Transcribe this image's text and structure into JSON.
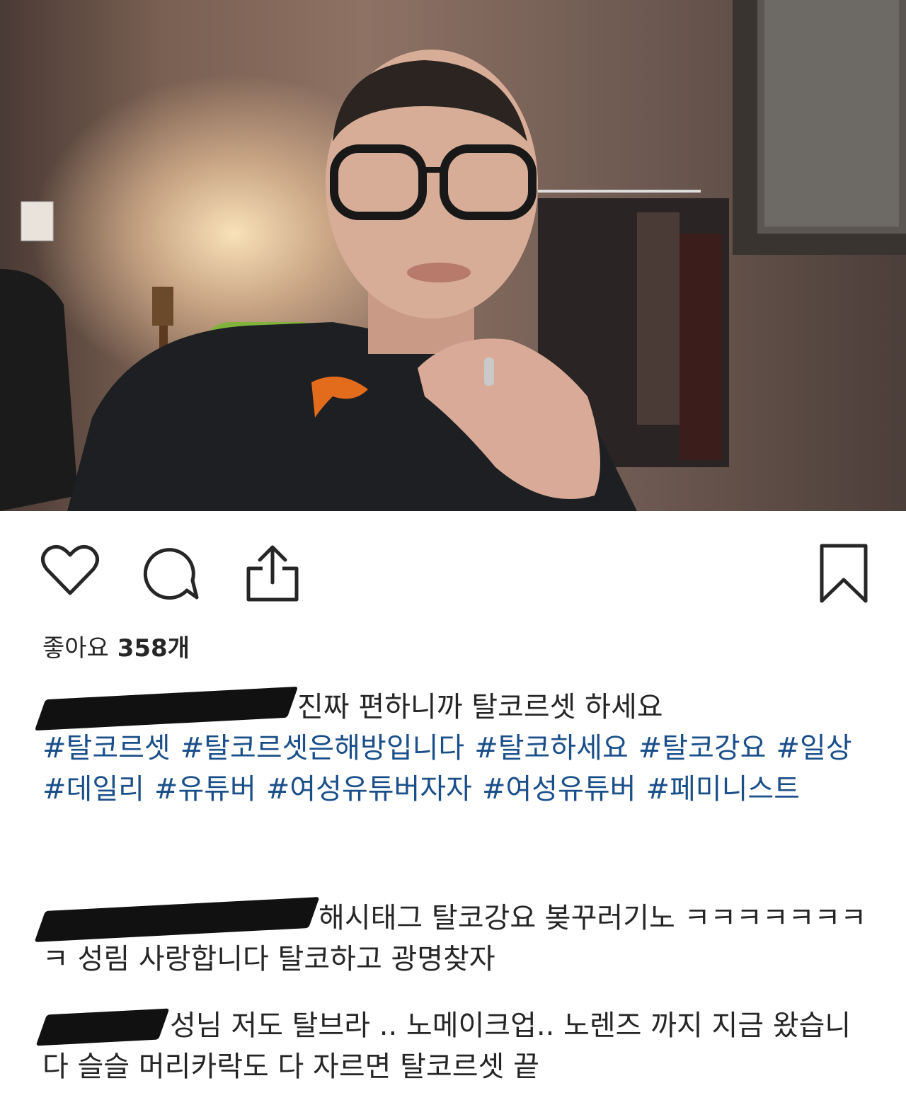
{
  "photo": {
    "alt_name": "post-photo"
  },
  "actions": {
    "like_icon": "heart-icon",
    "comment_icon": "comment-icon",
    "share_icon": "share-icon",
    "save_icon": "bookmark-icon"
  },
  "likes": {
    "label": "좋아요",
    "count": "358개"
  },
  "caption": {
    "text": "진짜 편하니까 탈코르셋 하세요",
    "hashtags": [
      "#탈코르셋",
      "#탈코르셋은해방입니다",
      "#탈코하세요",
      "#탈코강요",
      "#일상",
      "#데일리",
      "#유튜버",
      "#여성유튜버자자",
      "#여성유튜버",
      "#페미니스트"
    ]
  },
  "comments": [
    {
      "text": "해시태그 탈코강요 봊꾸러기노 ㅋㅋㅋㅋㅋㅋㅋㅋ 성림 사랑합니다 탈코하고 광명찾자"
    },
    {
      "text": "성님 저도 탈브라 .. 노메이크업.. 노렌즈 까지 지금 왔습니다 슬슬 머리카락도 다 자르면 탈코르셋 끝"
    }
  ],
  "colors": {
    "hashtag": "#1b4f8a",
    "text": "#262626",
    "background": "#ffffff"
  }
}
